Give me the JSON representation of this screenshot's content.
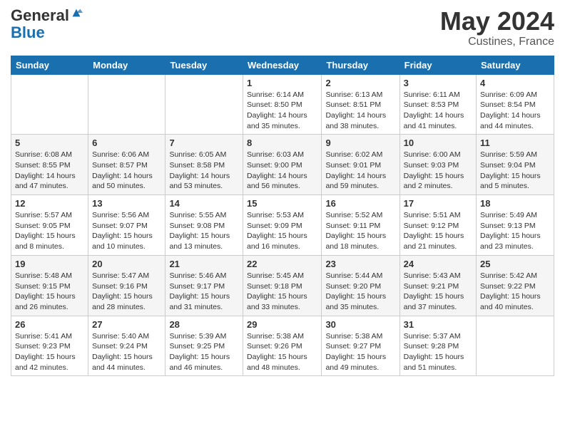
{
  "logo": {
    "general": "General",
    "blue": "Blue"
  },
  "title": "May 2024",
  "location": "Custines, France",
  "days_of_week": [
    "Sunday",
    "Monday",
    "Tuesday",
    "Wednesday",
    "Thursday",
    "Friday",
    "Saturday"
  ],
  "weeks": [
    [
      {
        "day": "",
        "sunrise": "",
        "sunset": "",
        "daylight": ""
      },
      {
        "day": "",
        "sunrise": "",
        "sunset": "",
        "daylight": ""
      },
      {
        "day": "",
        "sunrise": "",
        "sunset": "",
        "daylight": ""
      },
      {
        "day": "1",
        "sunrise": "Sunrise: 6:14 AM",
        "sunset": "Sunset: 8:50 PM",
        "daylight": "Daylight: 14 hours and 35 minutes."
      },
      {
        "day": "2",
        "sunrise": "Sunrise: 6:13 AM",
        "sunset": "Sunset: 8:51 PM",
        "daylight": "Daylight: 14 hours and 38 minutes."
      },
      {
        "day": "3",
        "sunrise": "Sunrise: 6:11 AM",
        "sunset": "Sunset: 8:53 PM",
        "daylight": "Daylight: 14 hours and 41 minutes."
      },
      {
        "day": "4",
        "sunrise": "Sunrise: 6:09 AM",
        "sunset": "Sunset: 8:54 PM",
        "daylight": "Daylight: 14 hours and 44 minutes."
      }
    ],
    [
      {
        "day": "5",
        "sunrise": "Sunrise: 6:08 AM",
        "sunset": "Sunset: 8:55 PM",
        "daylight": "Daylight: 14 hours and 47 minutes."
      },
      {
        "day": "6",
        "sunrise": "Sunrise: 6:06 AM",
        "sunset": "Sunset: 8:57 PM",
        "daylight": "Daylight: 14 hours and 50 minutes."
      },
      {
        "day": "7",
        "sunrise": "Sunrise: 6:05 AM",
        "sunset": "Sunset: 8:58 PM",
        "daylight": "Daylight: 14 hours and 53 minutes."
      },
      {
        "day": "8",
        "sunrise": "Sunrise: 6:03 AM",
        "sunset": "Sunset: 9:00 PM",
        "daylight": "Daylight: 14 hours and 56 minutes."
      },
      {
        "day": "9",
        "sunrise": "Sunrise: 6:02 AM",
        "sunset": "Sunset: 9:01 PM",
        "daylight": "Daylight: 14 hours and 59 minutes."
      },
      {
        "day": "10",
        "sunrise": "Sunrise: 6:00 AM",
        "sunset": "Sunset: 9:03 PM",
        "daylight": "Daylight: 15 hours and 2 minutes."
      },
      {
        "day": "11",
        "sunrise": "Sunrise: 5:59 AM",
        "sunset": "Sunset: 9:04 PM",
        "daylight": "Daylight: 15 hours and 5 minutes."
      }
    ],
    [
      {
        "day": "12",
        "sunrise": "Sunrise: 5:57 AM",
        "sunset": "Sunset: 9:05 PM",
        "daylight": "Daylight: 15 hours and 8 minutes."
      },
      {
        "day": "13",
        "sunrise": "Sunrise: 5:56 AM",
        "sunset": "Sunset: 9:07 PM",
        "daylight": "Daylight: 15 hours and 10 minutes."
      },
      {
        "day": "14",
        "sunrise": "Sunrise: 5:55 AM",
        "sunset": "Sunset: 9:08 PM",
        "daylight": "Daylight: 15 hours and 13 minutes."
      },
      {
        "day": "15",
        "sunrise": "Sunrise: 5:53 AM",
        "sunset": "Sunset: 9:09 PM",
        "daylight": "Daylight: 15 hours and 16 minutes."
      },
      {
        "day": "16",
        "sunrise": "Sunrise: 5:52 AM",
        "sunset": "Sunset: 9:11 PM",
        "daylight": "Daylight: 15 hours and 18 minutes."
      },
      {
        "day": "17",
        "sunrise": "Sunrise: 5:51 AM",
        "sunset": "Sunset: 9:12 PM",
        "daylight": "Daylight: 15 hours and 21 minutes."
      },
      {
        "day": "18",
        "sunrise": "Sunrise: 5:49 AM",
        "sunset": "Sunset: 9:13 PM",
        "daylight": "Daylight: 15 hours and 23 minutes."
      }
    ],
    [
      {
        "day": "19",
        "sunrise": "Sunrise: 5:48 AM",
        "sunset": "Sunset: 9:15 PM",
        "daylight": "Daylight: 15 hours and 26 minutes."
      },
      {
        "day": "20",
        "sunrise": "Sunrise: 5:47 AM",
        "sunset": "Sunset: 9:16 PM",
        "daylight": "Daylight: 15 hours and 28 minutes."
      },
      {
        "day": "21",
        "sunrise": "Sunrise: 5:46 AM",
        "sunset": "Sunset: 9:17 PM",
        "daylight": "Daylight: 15 hours and 31 minutes."
      },
      {
        "day": "22",
        "sunrise": "Sunrise: 5:45 AM",
        "sunset": "Sunset: 9:18 PM",
        "daylight": "Daylight: 15 hours and 33 minutes."
      },
      {
        "day": "23",
        "sunrise": "Sunrise: 5:44 AM",
        "sunset": "Sunset: 9:20 PM",
        "daylight": "Daylight: 15 hours and 35 minutes."
      },
      {
        "day": "24",
        "sunrise": "Sunrise: 5:43 AM",
        "sunset": "Sunset: 9:21 PM",
        "daylight": "Daylight: 15 hours and 37 minutes."
      },
      {
        "day": "25",
        "sunrise": "Sunrise: 5:42 AM",
        "sunset": "Sunset: 9:22 PM",
        "daylight": "Daylight: 15 hours and 40 minutes."
      }
    ],
    [
      {
        "day": "26",
        "sunrise": "Sunrise: 5:41 AM",
        "sunset": "Sunset: 9:23 PM",
        "daylight": "Daylight: 15 hours and 42 minutes."
      },
      {
        "day": "27",
        "sunrise": "Sunrise: 5:40 AM",
        "sunset": "Sunset: 9:24 PM",
        "daylight": "Daylight: 15 hours and 44 minutes."
      },
      {
        "day": "28",
        "sunrise": "Sunrise: 5:39 AM",
        "sunset": "Sunset: 9:25 PM",
        "daylight": "Daylight: 15 hours and 46 minutes."
      },
      {
        "day": "29",
        "sunrise": "Sunrise: 5:38 AM",
        "sunset": "Sunset: 9:26 PM",
        "daylight": "Daylight: 15 hours and 48 minutes."
      },
      {
        "day": "30",
        "sunrise": "Sunrise: 5:38 AM",
        "sunset": "Sunset: 9:27 PM",
        "daylight": "Daylight: 15 hours and 49 minutes."
      },
      {
        "day": "31",
        "sunrise": "Sunrise: 5:37 AM",
        "sunset": "Sunset: 9:28 PM",
        "daylight": "Daylight: 15 hours and 51 minutes."
      },
      {
        "day": "",
        "sunrise": "",
        "sunset": "",
        "daylight": ""
      }
    ]
  ]
}
